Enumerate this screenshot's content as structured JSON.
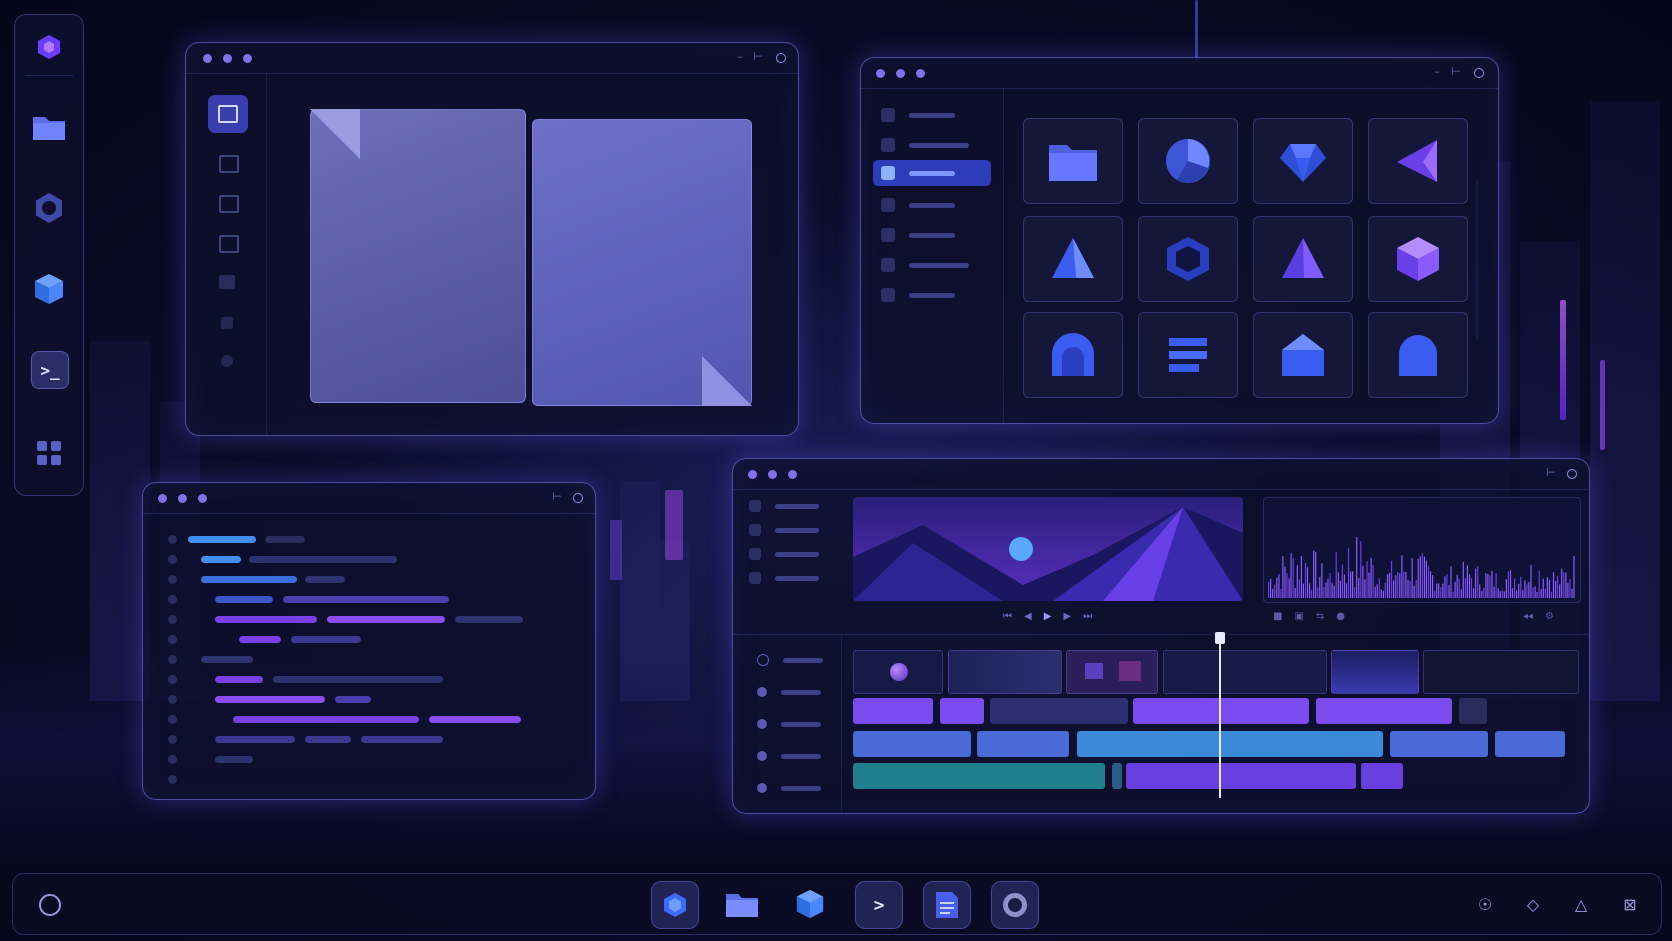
{
  "theme": {
    "accent": "#8f7cff",
    "purple": "#7b4dff",
    "blue": "#3e6ad8",
    "teal": "#1f7f8c",
    "panel": "#0e102c"
  },
  "left_dock": {
    "items": [
      {
        "icon": "hexagon-logo-icon",
        "active": true
      },
      {
        "icon": "folder-icon"
      },
      {
        "icon": "hexagon-ring-icon"
      },
      {
        "icon": "cube-icon"
      },
      {
        "icon": "terminal-icon",
        "label": ">_"
      },
      {
        "icon": "grid-apps-icon"
      }
    ]
  },
  "document_window": {
    "sidebar_icons": [
      "edit-icon",
      "page-icon",
      "image-icon",
      "page-icon",
      "square-icon",
      "square-icon",
      "circle-icon"
    ]
  },
  "asset_window": {
    "sidebar_rows": 7,
    "selected_row": 2,
    "tiles": [
      "folder-icon",
      "pie-chart-icon",
      "gem-icon",
      "pyramid-side-icon",
      "pyramid-icon",
      "cube-outline-icon",
      "pyramid-icon",
      "cube-purple-icon",
      "arch-icon",
      "stack-lines-icon",
      "house-shape-icon",
      "arch-icon"
    ]
  },
  "code_window": {
    "lines": 12
  },
  "editor_window": {
    "preview_controls": [
      "skip-back-icon",
      "prev-icon",
      "play-icon",
      "next-icon",
      "skip-forward-icon"
    ],
    "audio_controls": [
      "stop-icon",
      "square-icon",
      "loop-icon",
      "record-icon"
    ],
    "track_rows": 5,
    "playhead_position": 0.5
  },
  "taskbar": {
    "start_icon": "circle-icon",
    "apps": [
      {
        "icon": "hexagon-app-icon",
        "framed": true
      },
      {
        "icon": "folder-icon",
        "framed": false
      },
      {
        "icon": "cube-icon",
        "framed": false
      },
      {
        "icon": "terminal-icon",
        "framed": true,
        "label": ">"
      },
      {
        "icon": "document-icon",
        "framed": true
      },
      {
        "icon": "hexagon-ring-icon",
        "framed": true
      }
    ],
    "system_icons": [
      "sun-icon",
      "diamond-icon",
      "triangle-icon",
      "layout-icon"
    ]
  }
}
